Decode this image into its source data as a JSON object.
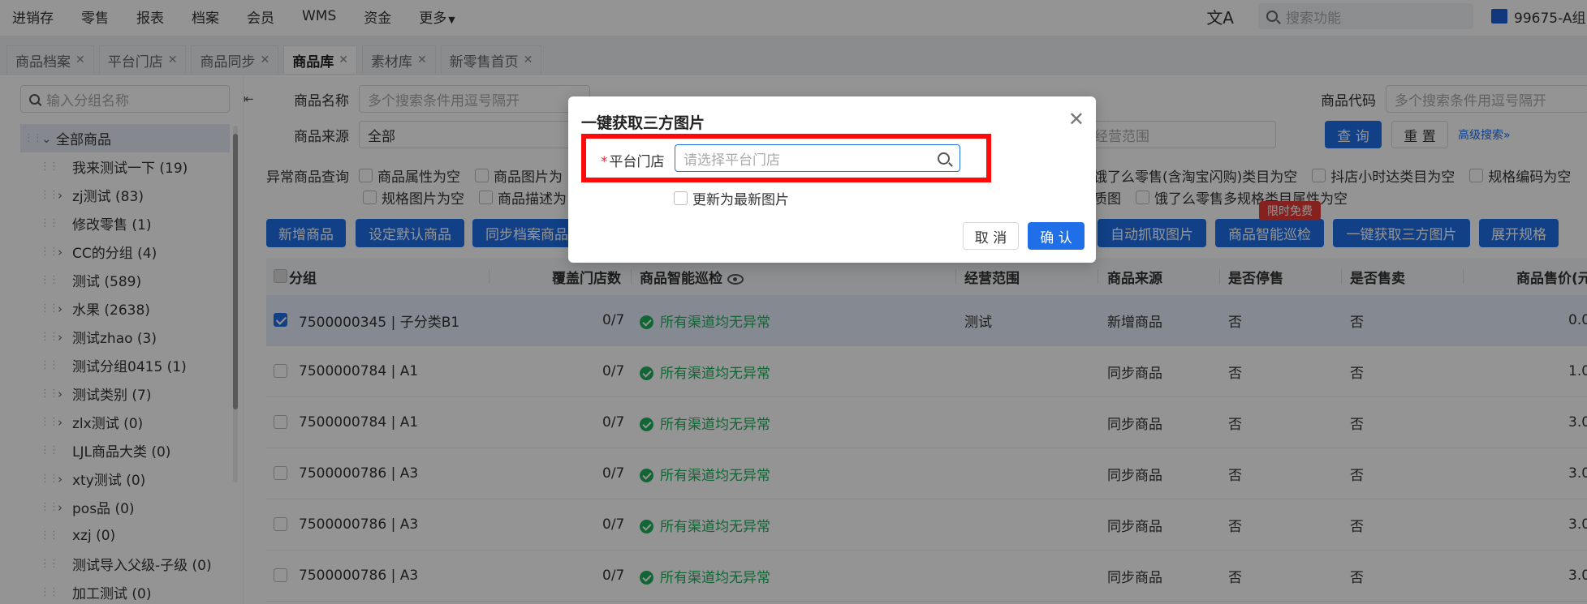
{
  "topnav": {
    "items": [
      "进销存",
      "零售",
      "报表",
      "档案",
      "会员",
      "WMS",
      "资金",
      "更多"
    ],
    "search_placeholder": "搜索功能",
    "store_name": "99675-A组"
  },
  "tabs": [
    {
      "label": "商品档案",
      "active": false
    },
    {
      "label": "平台门店",
      "active": false
    },
    {
      "label": "商品同步",
      "active": false
    },
    {
      "label": "商品库",
      "active": true
    },
    {
      "label": "素材库",
      "active": false
    },
    {
      "label": "新零售首页",
      "active": false
    }
  ],
  "sidebar": {
    "search_placeholder": "输入分组名称",
    "tree": [
      {
        "label": "全部商品",
        "level": 0,
        "expandable": true,
        "expanded": true
      },
      {
        "label": "我来测试一下 (19)",
        "level": 1,
        "expandable": false
      },
      {
        "label": "zj测试 (83)",
        "level": 1,
        "expandable": true
      },
      {
        "label": "修改零售 (1)",
        "level": 1,
        "expandable": false
      },
      {
        "label": "CC的分组 (4)",
        "level": 1,
        "expandable": true
      },
      {
        "label": "测试 (589)",
        "level": 1,
        "expandable": false
      },
      {
        "label": "水果 (2638)",
        "level": 1,
        "expandable": true
      },
      {
        "label": "测试zhao (3)",
        "level": 1,
        "expandable": true
      },
      {
        "label": "测试分组0415 (1)",
        "level": 1,
        "expandable": false
      },
      {
        "label": "测试类别 (7)",
        "level": 1,
        "expandable": true
      },
      {
        "label": "zlx测试 (0)",
        "level": 1,
        "expandable": true
      },
      {
        "label": "LJL商品大类 (0)",
        "level": 1,
        "expandable": false
      },
      {
        "label": "xty测试 (0)",
        "level": 1,
        "expandable": true
      },
      {
        "label": "pos品 (0)",
        "level": 1,
        "expandable": true
      },
      {
        "label": "xzj (0)",
        "level": 1,
        "expandable": false
      },
      {
        "label": "测试导入父级-子级 (0)",
        "level": 1,
        "expandable": false
      },
      {
        "label": "加工测试 (0)",
        "level": 1,
        "expandable": false
      }
    ]
  },
  "filters": {
    "name_label": "商品名称",
    "name_placeholder": "多个搜索条件用逗号隔开",
    "code_label": "商品代码",
    "code_placeholder": "多个搜索条件用逗号隔开",
    "source_label": "商品来源",
    "source_value": "全部",
    "scope_placeholder": "经营范围",
    "query_button": "查 询",
    "reset_button": "重 置",
    "advanced_link": "高级搜索",
    "abnormal_label": "异常商品查询",
    "checks_left": [
      "商品属性为空",
      "商品图片为",
      "规格图片为空",
      "商品描述为"
    ],
    "checks_right": [
      "饿了么零售(含淘宝闪购)类目为空",
      "抖店小时达类目为空",
      "规格编码为空",
      "质图",
      "饿了么零售多规格类目属性为空"
    ]
  },
  "actions": {
    "add": "新增商品",
    "set_default": "设定默认商品",
    "sync_archive": "同步档案商品",
    "auto_fetch": "自动抓取图片",
    "smart_patrol": "商品智能巡检",
    "fetch_third": "一键获取三方图片",
    "expand_spec": "展开规格",
    "free_badge": "限时免费"
  },
  "table": {
    "headers": {
      "group": "分组",
      "stores": "覆盖门店数",
      "patrol": "商品智能巡检",
      "scope": "经营范围",
      "source": "商品来源",
      "stopped": "是否停售",
      "selling": "是否售卖",
      "price": "商品售价(元"
    },
    "rows": [
      {
        "group": "7500000345 | 子分类B1",
        "stores": "0/7",
        "patrol": "所有渠道均无异常",
        "scope": "测试",
        "source": "新增商品",
        "stopped": "否",
        "selling": "否",
        "price": "0.0",
        "selected": true
      },
      {
        "group": "7500000784 | A1",
        "stores": "0/7",
        "patrol": "所有渠道均无异常",
        "scope": "",
        "source": "同步商品",
        "stopped": "否",
        "selling": "否",
        "price": "1.0",
        "selected": false
      },
      {
        "group": "7500000784 | A1",
        "stores": "0/7",
        "patrol": "所有渠道均无异常",
        "scope": "",
        "source": "同步商品",
        "stopped": "否",
        "selling": "否",
        "price": "3.0",
        "selected": false
      },
      {
        "group": "7500000786 | A3",
        "stores": "0/7",
        "patrol": "所有渠道均无异常",
        "scope": "",
        "source": "同步商品",
        "stopped": "否",
        "selling": "否",
        "price": "3.0",
        "selected": false
      },
      {
        "group": "7500000786 | A3",
        "stores": "0/7",
        "patrol": "所有渠道均无异常",
        "scope": "",
        "source": "同步商品",
        "stopped": "否",
        "selling": "否",
        "price": "3.0",
        "selected": false
      },
      {
        "group": "7500000786 | A3",
        "stores": "0/7",
        "patrol": "所有渠道均无异常",
        "scope": "",
        "source": "同步商品",
        "stopped": "否",
        "selling": "否",
        "price": "3.0",
        "selected": false
      }
    ]
  },
  "dialog": {
    "title": "一键获取三方图片",
    "field_label": "平台门店",
    "field_required_mark": "*",
    "field_placeholder": "请选择平台门店",
    "checkbox_label": "更新为最新图片",
    "cancel": "取 消",
    "confirm": "确 认",
    "highlight_color": "#ff0a0a"
  }
}
